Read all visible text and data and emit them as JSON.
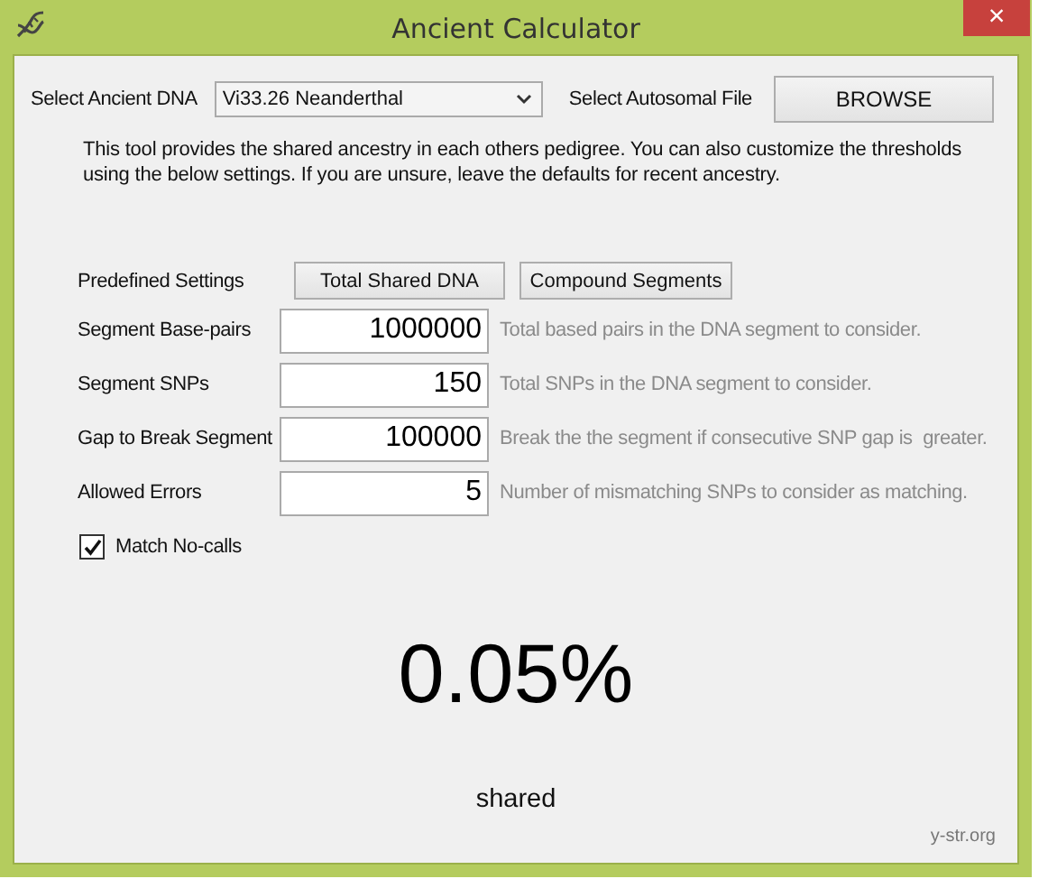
{
  "window": {
    "title": "Ancient Calculator",
    "close": "×"
  },
  "ancient_dna": {
    "label": "Select Ancient DNA",
    "value": "Vi33.26 Neanderthal"
  },
  "autosomal_file": {
    "label": "Select Autosomal File",
    "button": "BROWSE"
  },
  "description": "This tool provides the shared ancestry in each others pedigree. You can also customize the thresholds using the below settings. If you are unsure, leave the defaults for recent ancestry.",
  "predefined": {
    "label": "Predefined Settings",
    "buttons": [
      "Total Shared DNA",
      "Compound Segments"
    ]
  },
  "settings": [
    {
      "label": "Segment Base-pairs",
      "value": "1000000",
      "hint": "Total based pairs in the DNA segment to consider."
    },
    {
      "label": "Segment SNPs",
      "value": "150",
      "hint": "Total SNPs in the DNA segment to consider."
    },
    {
      "label": "Gap to Break Segment",
      "value": "100000",
      "hint": "Break the the segment if consecutive SNP gap is  greater."
    },
    {
      "label": "Allowed Errors",
      "value": "5",
      "hint": "Number of mismatching SNPs to consider as matching."
    }
  ],
  "match_no_calls": {
    "label": "Match No-calls",
    "checked": true
  },
  "result": {
    "value": "0.05%",
    "caption": "shared"
  },
  "credit": "y-str.org"
}
